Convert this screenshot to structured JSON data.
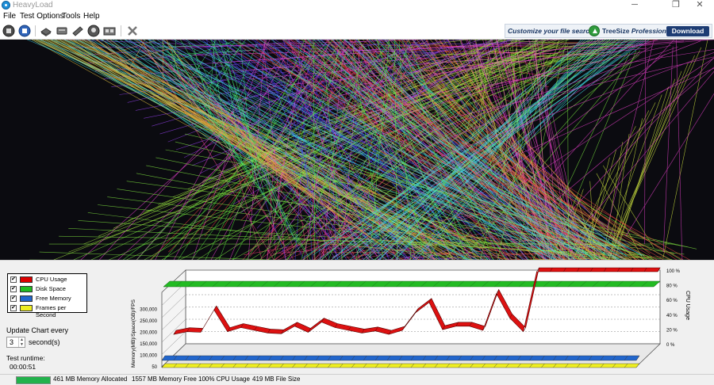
{
  "window": {
    "title": "HeavyLoad"
  },
  "window_controls": {
    "minimize": "─",
    "maximize": "❐",
    "close": "✕"
  },
  "menu": [
    "File",
    "Test Options",
    "Tools",
    "Help"
  ],
  "toolbar_icons": [
    "stop-icon",
    "start-icon",
    "cpu-icon",
    "disk-icon",
    "memory-icon",
    "gpu-icon",
    "device-icon",
    "settings-icon"
  ],
  "ad": {
    "tagline": "Customize your file search",
    "brand": "TreeSize",
    "brand_sub": "Professional",
    "download": "Download"
  },
  "legend": [
    {
      "label": "CPU Usage",
      "color": "#dd0000",
      "checked": "✔"
    },
    {
      "label": "Disk Space",
      "color": "#22bb22",
      "checked": "✔"
    },
    {
      "label": "Free Memory",
      "color": "#2266cc",
      "checked": "✔"
    },
    {
      "label": "Frames per Second",
      "color": "#eeee22",
      "checked": "✔"
    }
  ],
  "update": {
    "label": "Update Chart every",
    "value": "3",
    "suffix": "second(s)"
  },
  "runtime": {
    "label": "Test runtime:",
    "value": "00:00:51"
  },
  "chart_data": {
    "type": "area",
    "ylabel_left": "Memory(MB)/Space(GB)/FPS",
    "ylabel_right": "CPU Usage",
    "left_ticks": [
      "50",
      "100,000",
      "150,000",
      "200,000",
      "250,000",
      "300,000"
    ],
    "right_ticks": [
      "0 %",
      "20 %",
      "40 %",
      "60 %",
      "80 %",
      "100 %"
    ],
    "series": [
      {
        "name": "CPU Usage",
        "unit": "%",
        "values": [
          8,
          12,
          11,
          44,
          12,
          18,
          14,
          10,
          9,
          20,
          11,
          26,
          18,
          14,
          10,
          13,
          8,
          14,
          40,
          55,
          15,
          20,
          20,
          14,
          68,
          32,
          12,
          100,
          100,
          100,
          100,
          100,
          100,
          100,
          100,
          100,
          100
        ]
      },
      {
        "name": "Disk Space",
        "constant": true
      },
      {
        "name": "Free Memory",
        "constant": true
      },
      {
        "name": "Frames per Second",
        "constant": true
      }
    ]
  },
  "status": {
    "memory_progress": 1.0,
    "allocated": "461 MB Memory Allocated",
    "free": "1557 MB Memory Free",
    "cpu": "100% CPU Usage",
    "file": "419 MB File Size"
  }
}
